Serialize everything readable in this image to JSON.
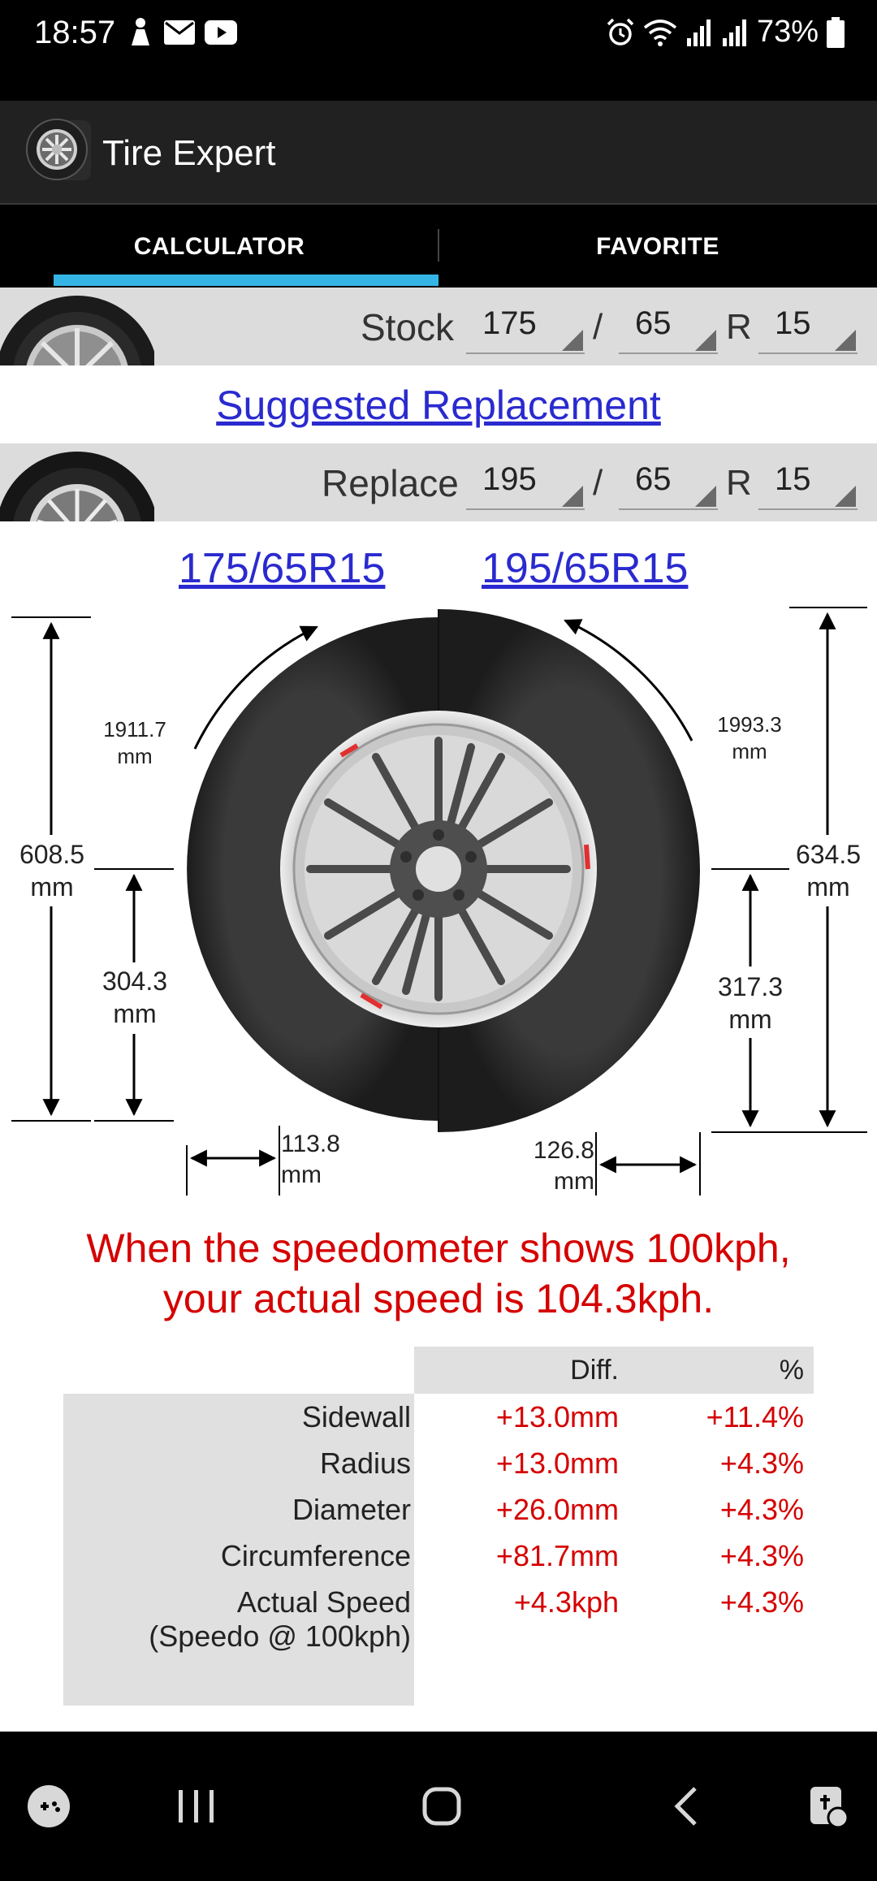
{
  "status_bar": {
    "time": "18:57",
    "battery": "73%"
  },
  "app_bar": {
    "title": "Tire Expert"
  },
  "tabs": [
    {
      "label": "CALCULATOR",
      "selected": true
    },
    {
      "label": "FAVORITE",
      "selected": false
    }
  ],
  "stock": {
    "label": "Stock",
    "width": "175",
    "separator": "/",
    "aspect": "65",
    "r_label": "R",
    "rim": "15"
  },
  "suggest": {
    "label": "Suggested Replacement"
  },
  "replace": {
    "label": "Replace",
    "width": "195",
    "separator": "/",
    "aspect": "65",
    "r_label": "R",
    "rim": "15"
  },
  "diagram": {
    "stock_size": "175/65R15",
    "replace_size": "195/65R15",
    "stock_circ_value": "1911.7",
    "replace_circ_value": "1993.3",
    "stock_diameter_value": "608.5",
    "replace_diameter_value": "634.5",
    "stock_radius_value": "304.3",
    "replace_radius_value": "317.3",
    "stock_sidewall_value": "113.8",
    "replace_sidewall_value": "126.8",
    "unit": "mm"
  },
  "speed_message": {
    "line1": "When the speedometer shows 100kph,",
    "line2": "your actual speed is 104.3kph."
  },
  "comparison": {
    "col_diff": "Diff.",
    "col_pct": "%",
    "rows": [
      {
        "label": "Sidewall",
        "diff": "+13.0mm",
        "pct": "+11.4%"
      },
      {
        "label": "Radius",
        "diff": "+13.0mm",
        "pct": "+4.3%"
      },
      {
        "label": "Diameter",
        "diff": "+26.0mm",
        "pct": "+4.3%"
      },
      {
        "label": "Circumference",
        "diff": "+81.7mm",
        "pct": "+4.3%"
      },
      {
        "label": "Actual Speed",
        "sublabel": "(Speedo @ 100kph)",
        "diff": "+4.3kph",
        "pct": "+4.3%"
      }
    ]
  },
  "colors": {
    "tab_indicator": "#35b5e5",
    "link": "#2a2ad0",
    "alert_red": "#d50000",
    "app_bar": "#212121"
  }
}
